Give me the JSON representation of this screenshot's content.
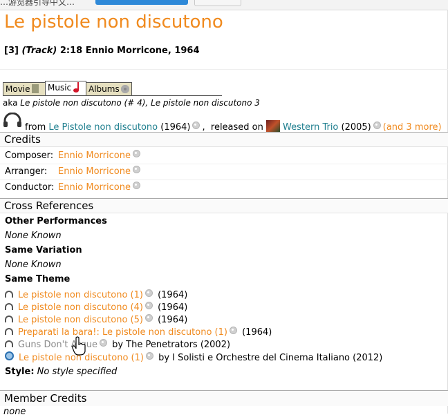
{
  "top": {
    "cut_text": "…游览器引导中文…"
  },
  "page": {
    "title": "Le pistole non discutono"
  },
  "track": {
    "number": "[3]",
    "type": "(Track)",
    "duration_artist_year": "2:18 Ennio Morricone, 1964"
  },
  "tabs": [
    {
      "label": "Movie"
    },
    {
      "label": "Music"
    },
    {
      "label": "Albums"
    }
  ],
  "aka": {
    "prefix": "aka ",
    "text": "Le pistole non discutono (# 4), Le pistole non discutono 3"
  },
  "from": {
    "prefix": "from ",
    "film": "Le Pistole non discutono",
    "film_year": "(1964)",
    "released_on": ",  released on ",
    "album": "Western Trio",
    "album_year": "(2005)",
    "more": "(and 3 more)"
  },
  "credits": {
    "header": "Credits",
    "rows": [
      {
        "label": "Composer:",
        "value": "Ennio Morricone"
      },
      {
        "label": "Arranger:",
        "value": "Ennio Morricone"
      },
      {
        "label": "Conductor:",
        "value": "Ennio Morricone"
      }
    ]
  },
  "crossref": {
    "header": "Cross References",
    "other_performances": "Other Performances",
    "other_none": "None Known",
    "same_variation": "Same Variation",
    "variation_none": "None Known",
    "same_theme": "Same Theme",
    "theme_items": [
      {
        "title": "Le pistole non discutono (1)",
        "after": "(1964)"
      },
      {
        "title": "Le pistole non discutono (4)",
        "after": "(1964)"
      },
      {
        "title": "Le pistole non discutono (5)",
        "after": "(1964)"
      },
      {
        "title": "Preparati la bara!: Le pistole non discutono (1)",
        "after": "(1964)"
      },
      {
        "title": "Guns Don't Argue",
        "after": "by The Penetrators (2002)"
      },
      {
        "title": "Le pistole non discutono (1)",
        "after": "by I Solisti e Orchestre del Cinema Italiano (2012)"
      }
    ],
    "style_label": "Style:",
    "style_value": "No style specified"
  },
  "member": {
    "header": "Member Credits",
    "value": "none"
  }
}
